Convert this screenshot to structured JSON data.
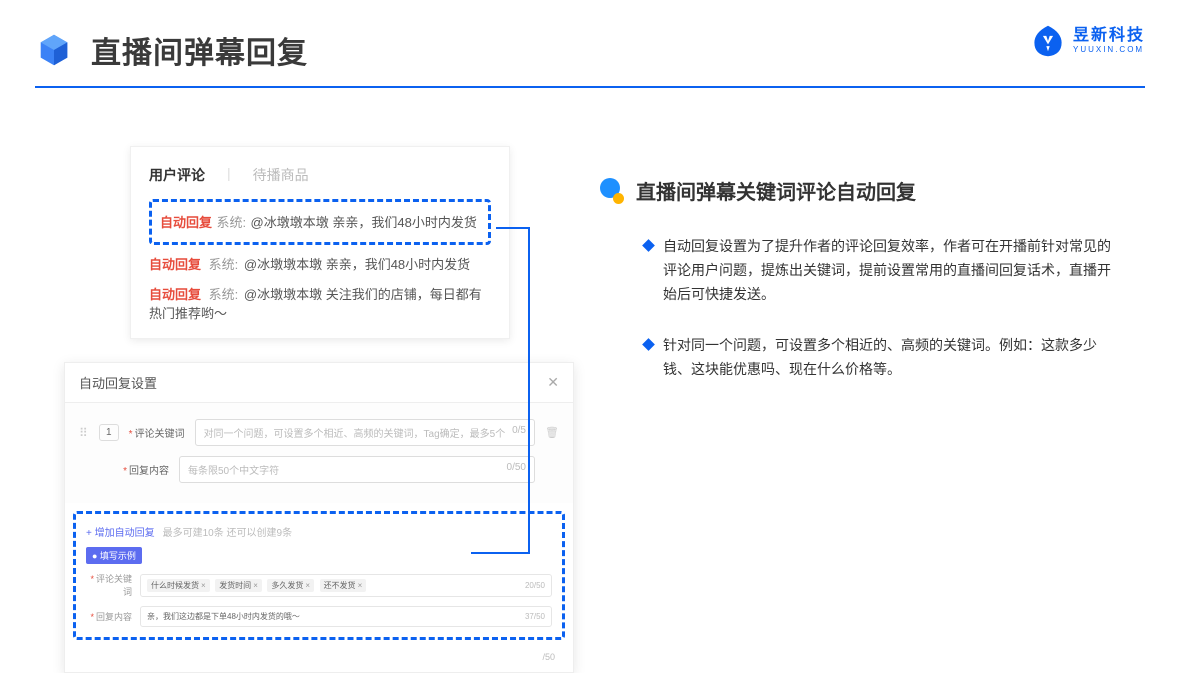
{
  "header": {
    "title": "直播间弹幕回复",
    "brand_cn": "昱新科技",
    "brand_en": "YUUXIN.COM"
  },
  "mock_top": {
    "tab_active": "用户评论",
    "tab_inactive": "待播商品",
    "c1": {
      "tag": "自动回复",
      "sys": "系统:",
      "txt": "@冰墩墩本墩 亲亲，我们48小时内发货"
    },
    "c2": {
      "tag": "自动回复",
      "sys": "系统:",
      "txt": "@冰墩墩本墩 亲亲，我们48小时内发货"
    },
    "c3": {
      "tag": "自动回复",
      "sys": "系统:",
      "txt": "@冰墩墩本墩 关注我们的店铺，每日都有热门推荐哟～"
    }
  },
  "mock_bot": {
    "title": "自动回复设置",
    "num": "1",
    "l1": "评论关键词",
    "p1": "对同一个问题，可设置多个相近、高频的关键词，Tag确定，最多5个",
    "cnt1": "0/5",
    "l2": "回复内容",
    "p2": "每条限50个中文字符",
    "cnt2": "0/50",
    "add": "+ 增加自动回复",
    "add_hint": "最多可建10条 还可以创建9条",
    "badge": "● 填写示例",
    "ex1_label": "评论关键词",
    "ex1_tags": [
      "什么时候发货",
      "发货时间",
      "多久发货",
      "还不发货"
    ],
    "ex1_cnt": "20/50",
    "ex2_label": "回复内容",
    "ex2_txt": "亲，我们这边都是下单48小时内发货的哦～",
    "ex2_cnt": "37/50",
    "outer_cnt": "/50"
  },
  "right": {
    "title": "直播间弹幕关键词评论自动回复",
    "b1": "自动回复设置为了提升作者的评论回复效率，作者可在开播前针对常见的评论用户问题，提炼出关键词，提前设置常用的直播间回复话术，直播开始后可快捷发送。",
    "b2": "针对同一个问题，可设置多个相近的、高频的关键词。例如：这款多少钱、这块能优惠吗、现在什么价格等。"
  }
}
